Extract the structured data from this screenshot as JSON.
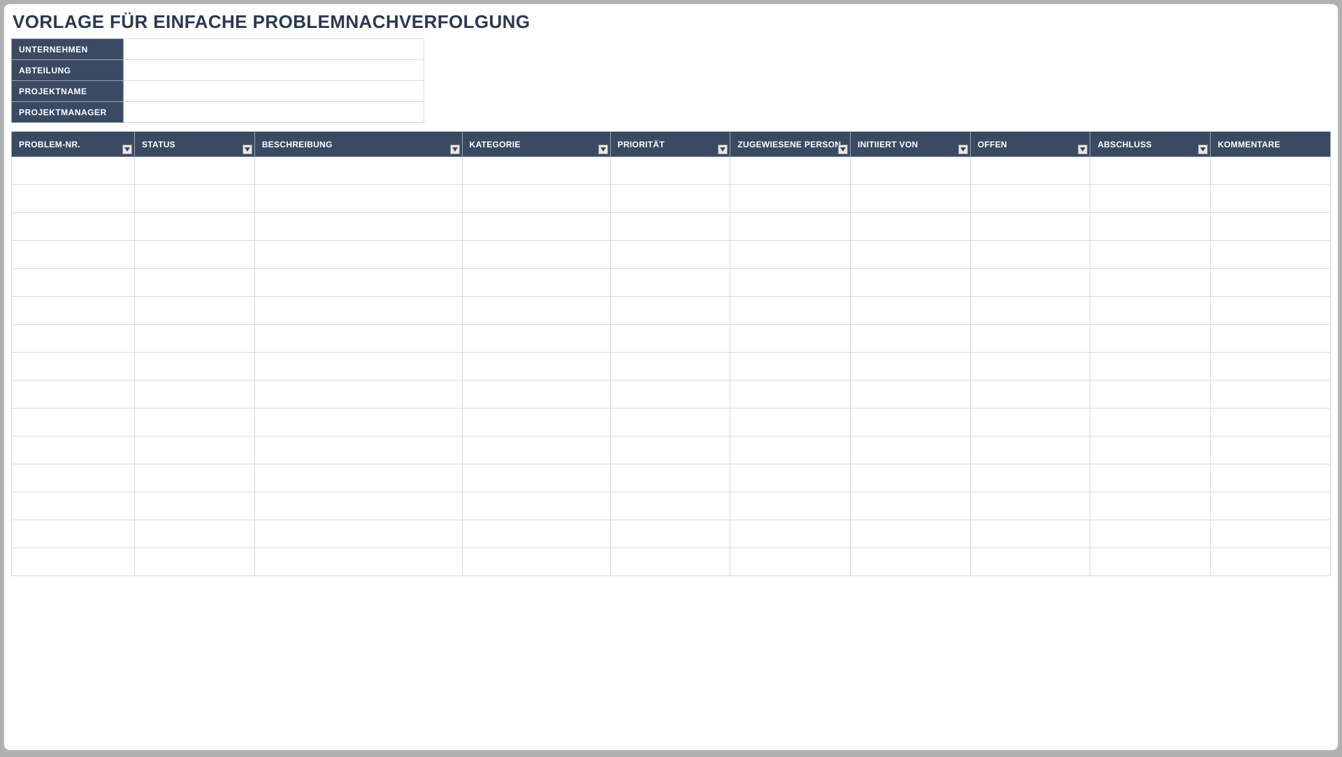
{
  "title": "VORLAGE FÜR EINFACHE PROBLEMNACHVERFOLGUNG",
  "meta": {
    "fields": [
      {
        "label": "UNTERNEHMEN",
        "value": ""
      },
      {
        "label": "ABTEILUNG",
        "value": ""
      },
      {
        "label": "PROJEKTNAME",
        "value": ""
      },
      {
        "label": "PROJEKTMANAGER",
        "value": ""
      }
    ]
  },
  "columns": [
    {
      "label": "PROBLEM-NR.",
      "filter": true
    },
    {
      "label": "STATUS",
      "filter": true
    },
    {
      "label": "BESCHREIBUNG",
      "filter": true
    },
    {
      "label": "KATEGORIE",
      "filter": true
    },
    {
      "label": "PRIORITÄT",
      "filter": true
    },
    {
      "label": "ZUGEWIESENE PERSON",
      "filter": true
    },
    {
      "label": "INITIIERT VON",
      "filter": true
    },
    {
      "label": "OFFEN",
      "filter": true
    },
    {
      "label": "ABSCHLUSS",
      "filter": true
    },
    {
      "label": "KOMMENTARE",
      "filter": false
    }
  ],
  "row_count": 15,
  "colors": {
    "header_bg": "#3a4a63",
    "header_text": "#ffffff",
    "title_text": "#2a3952",
    "cell_border": "#d7d9dc"
  }
}
